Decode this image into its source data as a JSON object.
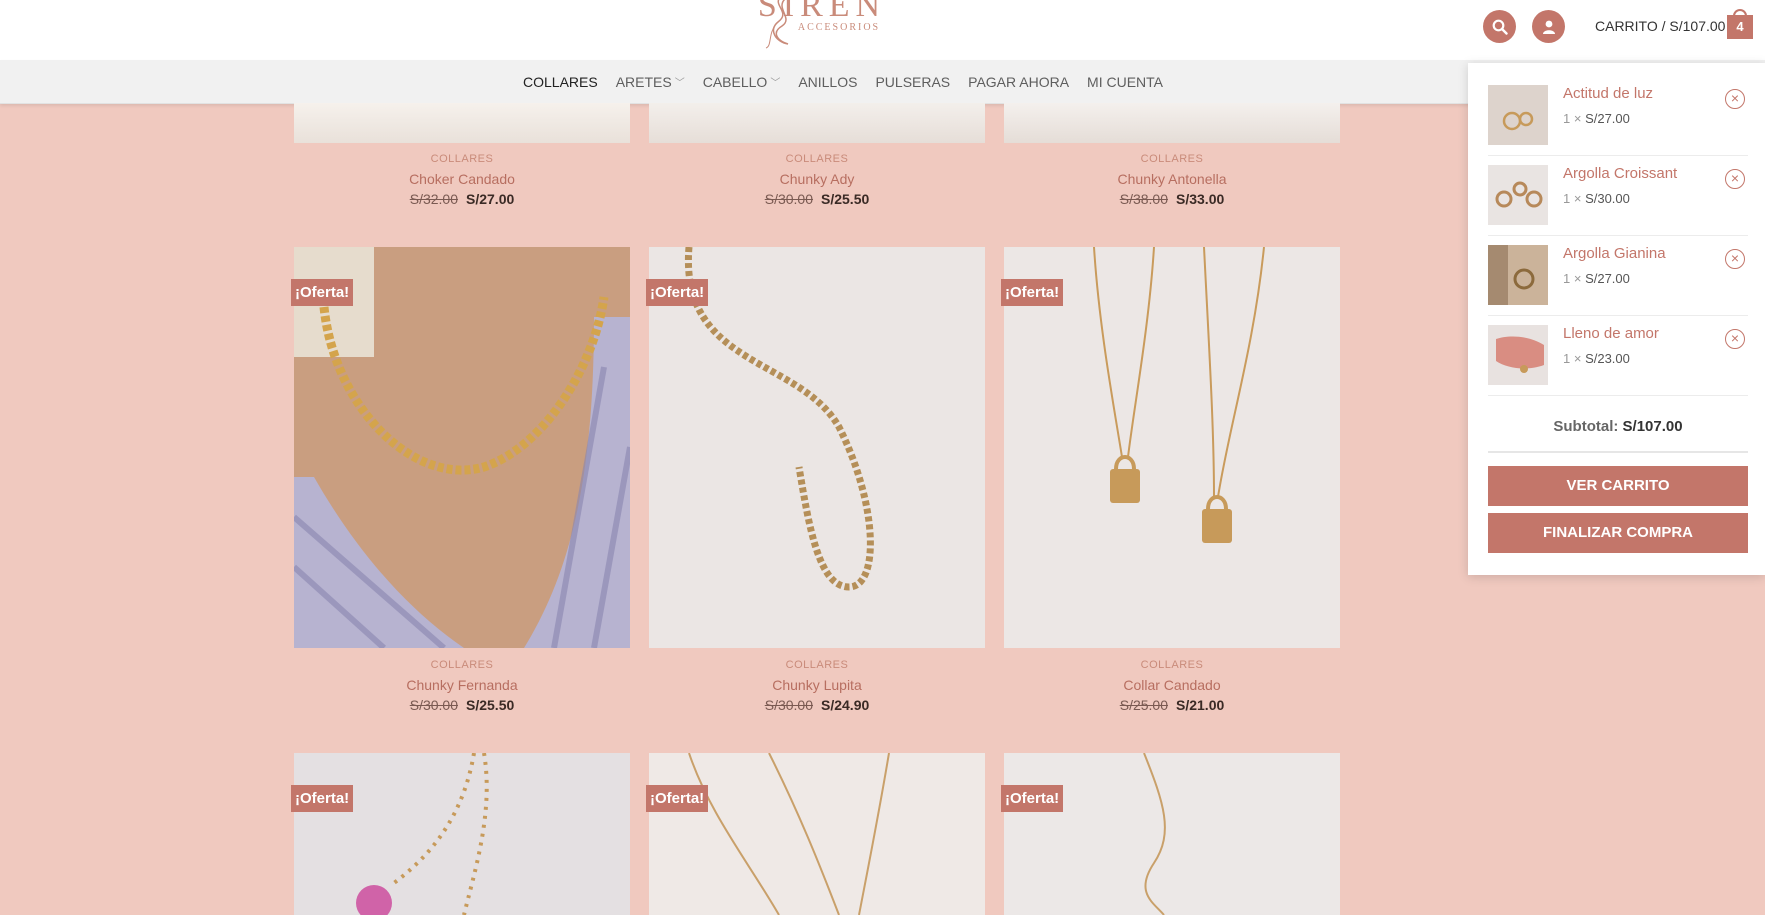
{
  "brand": {
    "name": "SIREN",
    "tagline": "ACCESORIOS"
  },
  "header": {
    "search_icon": "search-icon",
    "account_icon": "user-icon",
    "cart_label": "CARRITO / ",
    "cart_total": "S/107.00",
    "cart_count": "4"
  },
  "nav": {
    "items": [
      {
        "label": "COLLARES",
        "active": true,
        "dropdown": false
      },
      {
        "label": "ARETES",
        "active": false,
        "dropdown": true
      },
      {
        "label": "CABELLO",
        "active": false,
        "dropdown": true
      },
      {
        "label": "ANILLOS",
        "active": false,
        "dropdown": false
      },
      {
        "label": "PULSERAS",
        "active": false,
        "dropdown": false
      },
      {
        "label": "PAGAR AHORA",
        "active": false,
        "dropdown": false
      },
      {
        "label": "MI CUENTA",
        "active": false,
        "dropdown": false
      }
    ]
  },
  "products": [
    {
      "category": "COLLARES",
      "name": "Choker Candado",
      "old_price": "S/32.00",
      "price": "S/27.00",
      "badge": ""
    },
    {
      "category": "COLLARES",
      "name": "Chunky Ady",
      "old_price": "S/30.00",
      "price": "S/25.50",
      "badge": ""
    },
    {
      "category": "COLLARES",
      "name": "Chunky Antonella",
      "old_price": "S/38.00",
      "price": "S/33.00",
      "badge": ""
    },
    {
      "category": "COLLARES",
      "name": "Chunky Fernanda",
      "old_price": "S/30.00",
      "price": "S/25.50",
      "badge": "¡Oferta!"
    },
    {
      "category": "COLLARES",
      "name": "Chunky Lupita",
      "old_price": "S/30.00",
      "price": "S/24.90",
      "badge": "¡Oferta!"
    },
    {
      "category": "COLLARES",
      "name": "Collar Candado",
      "old_price": "S/25.00",
      "price": "S/21.00",
      "badge": "¡Oferta!"
    },
    {
      "badge": "¡Oferta!"
    },
    {
      "badge": "¡Oferta!"
    },
    {
      "badge": "¡Oferta!"
    }
  ],
  "cart": {
    "items": [
      {
        "name": "Actitud de luz",
        "qty": "1 ×",
        "price": "S/27.00"
      },
      {
        "name": "Argolla Croissant",
        "qty": "1 ×",
        "price": "S/30.00"
      },
      {
        "name": "Argolla Gianina",
        "qty": "1 ×",
        "price": "S/27.00"
      },
      {
        "name": "Lleno de amor",
        "qty": "1 ×",
        "price": "S/23.00"
      }
    ],
    "remove_symbol": "×",
    "subtotal_label": "Subtotal:",
    "subtotal_value": "S/107.00",
    "view_cart": "VER CARRITO",
    "checkout": "FINALIZAR COMPRA"
  },
  "colors": {
    "background": "#f0c9bf",
    "accent": "#c3766a",
    "link": "#b76e60"
  }
}
